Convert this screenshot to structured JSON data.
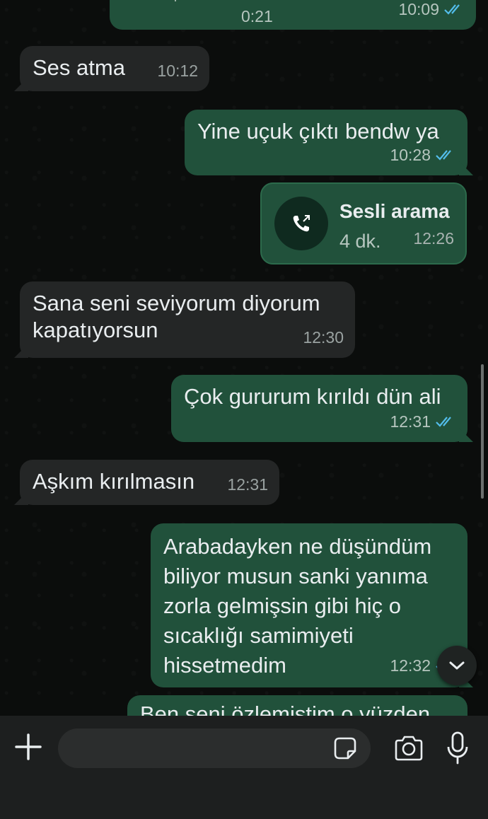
{
  "messages": {
    "top_voice": {
      "duration": "0:21",
      "time": "10:09"
    },
    "m1": {
      "text": "Ses atma",
      "time": "10:12"
    },
    "m2": {
      "text": "Yine uçuk çıktı bendw ya",
      "time": "10:28"
    },
    "call": {
      "title": "Sesli arama",
      "subtitle": "4 dk.",
      "time": "12:26"
    },
    "m3": {
      "line1": "Sana seni seviyorum diyorum",
      "line2": "kapatıyorsun",
      "time": "12:30"
    },
    "m4": {
      "text": "Çok gururum kırıldı dün ali",
      "time": "12:31"
    },
    "m5": {
      "text": "Aşkım kırılmasın",
      "time": "12:31"
    },
    "m6": {
      "line1": "Arabadayken ne düşündüm",
      "line2": "biliyor musun sanki yanıma",
      "line3": "zorla gelmişsin gibi hiç o",
      "line4": "sıcaklığı samimiyeti",
      "line5": "hissetmedim",
      "time": "12:32"
    },
    "m7": {
      "text": "Ben seni özlemiştim o yüzden"
    }
  },
  "composer": {
    "placeholder": ""
  },
  "icons": {
    "plus": "plus-icon",
    "sticker": "sticker-icon",
    "camera": "camera-icon",
    "mic": "microphone-icon",
    "scroll": "chevron-down-icon",
    "call": "outgoing-call-icon",
    "ticks": "double-check-icon"
  },
  "colors": {
    "incoming_bubble": "#242626",
    "outgoing_bubble": "#21513b",
    "read_ticks": "#53bdeb",
    "background": "#0b0d0c"
  }
}
